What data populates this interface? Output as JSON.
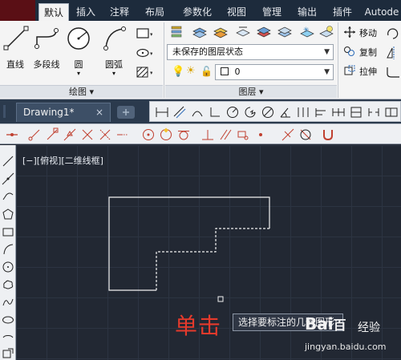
{
  "ribbon_tabs": [
    "默认",
    "插入",
    "注释",
    "布局",
    "参数化",
    "视图",
    "管理",
    "输出",
    "插件",
    "Autode"
  ],
  "draw_panel": {
    "title": "绘图",
    "buttons": [
      "直线",
      "多段线",
      "圆",
      "圆弧"
    ]
  },
  "layers_panel": {
    "title": "图层",
    "layer_state": "未保存的图层状态",
    "current_layer": "0"
  },
  "modify_panel": {
    "buttons": [
      "移动",
      "复制",
      "拉伸"
    ]
  },
  "document_tab": {
    "title": "Drawing1*",
    "close": "×"
  },
  "viewport_label": "[−][俯视][二维线框]",
  "annotation_text": "单击",
  "tooltip_text": "选择要标注的几何图形:",
  "watermark": {
    "logo": "Bai",
    "logo2": "百",
    "cn": "经验",
    "url": "jingyan.baidu.com"
  },
  "colors": {
    "ribbon_tab_bg": "#1d2b3c",
    "ribbon_bg": "#f4f4f4",
    "canvas_bg": "#222833",
    "annotation_red": "#e53a2c"
  }
}
